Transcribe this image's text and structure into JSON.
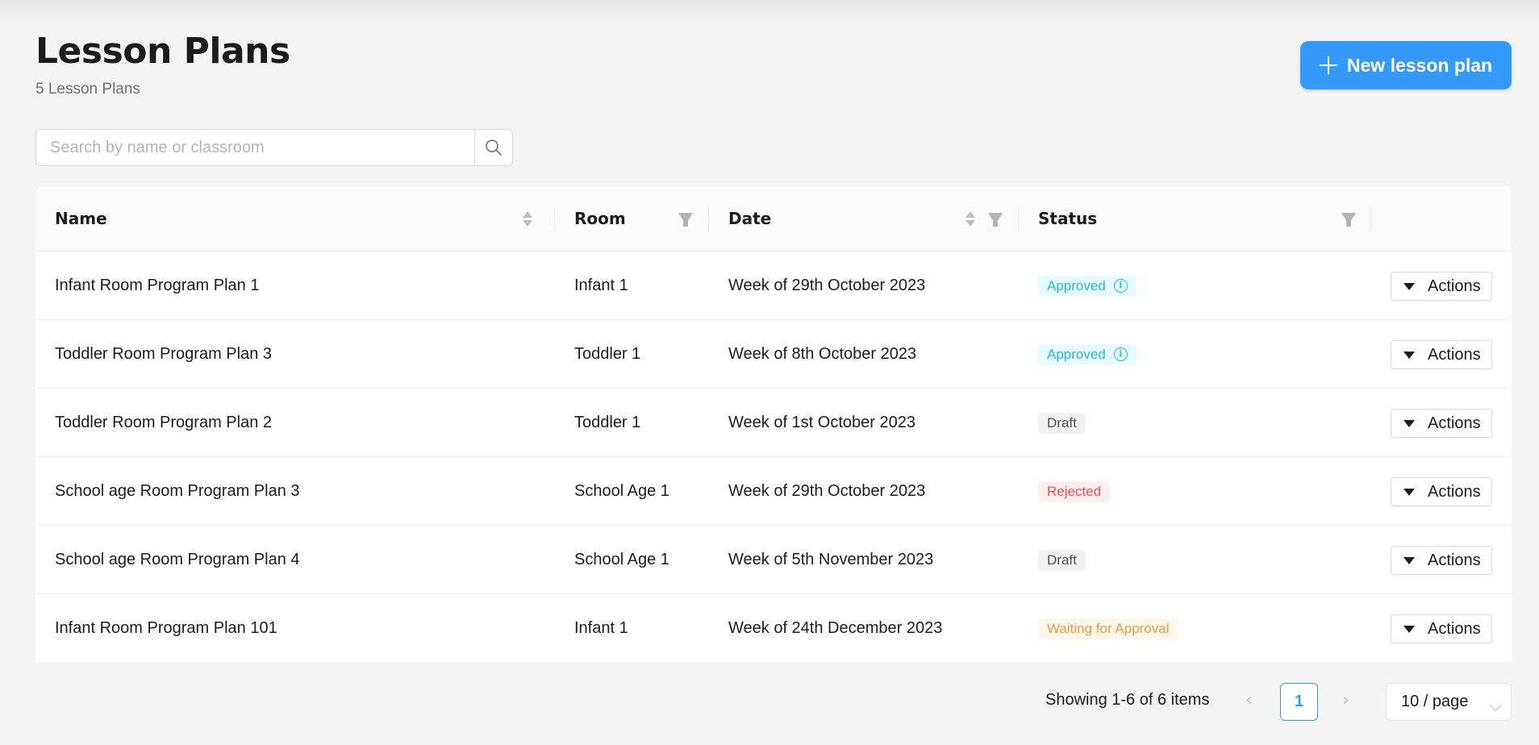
{
  "header": {
    "title": "Lesson Plans",
    "subtitle": "5 Lesson Plans",
    "new_button_label": "New lesson plan"
  },
  "search": {
    "placeholder": "Search by name or classroom",
    "value": ""
  },
  "table": {
    "columns": [
      {
        "label": "Name",
        "sortable": true,
        "filterable": false
      },
      {
        "label": "Room",
        "sortable": false,
        "filterable": true
      },
      {
        "label": "Date",
        "sortable": true,
        "filterable": true
      },
      {
        "label": "Status",
        "sortable": false,
        "filterable": true
      },
      {
        "label": "",
        "sortable": false,
        "filterable": false
      }
    ],
    "rows": [
      {
        "name": "Infant Room Program Plan 1",
        "room": "Infant 1",
        "date": "Week of 29th October 2023",
        "status": "Approved",
        "status_type": "approved",
        "has_info": true,
        "action": "Actions"
      },
      {
        "name": "Toddler Room Program Plan 3",
        "room": "Toddler 1",
        "date": "Week of 8th October 2023",
        "status": "Approved",
        "status_type": "approved",
        "has_info": true,
        "action": "Actions"
      },
      {
        "name": "Toddler Room Program Plan 2",
        "room": "Toddler 1",
        "date": "Week of 1st October 2023",
        "status": "Draft",
        "status_type": "draft",
        "has_info": false,
        "action": "Actions"
      },
      {
        "name": "School age Room Program Plan 3",
        "room": "School Age 1",
        "date": "Week of 29th October 2023",
        "status": "Rejected",
        "status_type": "rejected",
        "has_info": false,
        "action": "Actions"
      },
      {
        "name": "School age Room Program Plan 4",
        "room": "School Age 1",
        "date": "Week of 5th November 2023",
        "status": "Draft",
        "status_type": "draft",
        "has_info": false,
        "action": "Actions"
      },
      {
        "name": "Infant Room Program Plan 101",
        "room": "Infant 1",
        "date": "Week of 24th December 2023",
        "status": "Waiting for Approval",
        "status_type": "waiting",
        "has_info": false,
        "action": "Actions"
      }
    ]
  },
  "pagination": {
    "summary": "Showing 1-6 of 6 items",
    "prev": "‹",
    "next": "›",
    "current_page": "1",
    "page_size": "10 / page"
  },
  "colors": {
    "accent": "#3599fa",
    "approved": "#29b6cc",
    "draft": "#505050",
    "rejected": "#f04b55",
    "waiting": "#e39a4a"
  }
}
